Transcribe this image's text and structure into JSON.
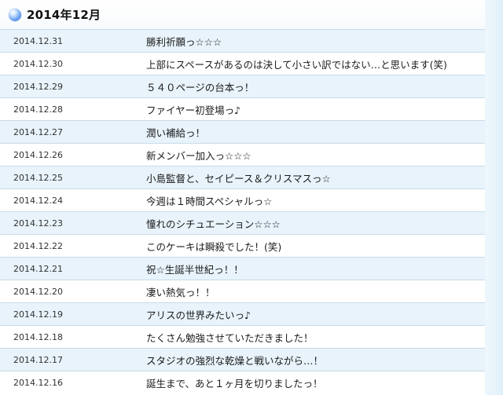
{
  "header": {
    "month_title": "2014年12月"
  },
  "entries": [
    {
      "date": "2014.12.31",
      "title": "勝利祈願っ☆☆☆"
    },
    {
      "date": "2014.12.30",
      "title": "上部にスペースがあるのは決して小さい訳ではない…と思います(笑)"
    },
    {
      "date": "2014.12.29",
      "title": "５４０ページの台本っ！"
    },
    {
      "date": "2014.12.28",
      "title": "ファイヤー初登場っ♪"
    },
    {
      "date": "2014.12.27",
      "title": "潤い補給っ！"
    },
    {
      "date": "2014.12.26",
      "title": "新メンバー加入っ☆☆☆"
    },
    {
      "date": "2014.12.25",
      "title": "小島監督と、セイピース＆クリスマスっ☆"
    },
    {
      "date": "2014.12.24",
      "title": "今週は１時間スペシャルっ☆"
    },
    {
      "date": "2014.12.23",
      "title": "憧れのシチュエーション☆☆☆"
    },
    {
      "date": "2014.12.22",
      "title": "このケーキは瞬殺でした！(笑)"
    },
    {
      "date": "2014.12.21",
      "title": "祝☆生誕半世紀っ！！"
    },
    {
      "date": "2014.12.20",
      "title": "凄い熱気っ！！"
    },
    {
      "date": "2014.12.19",
      "title": "アリスの世界みたいっ♪"
    },
    {
      "date": "2014.12.18",
      "title": "たくさん勉強させていただきました！"
    },
    {
      "date": "2014.12.17",
      "title": "スタジオの強烈な乾燥と戦いながら…！"
    },
    {
      "date": "2014.12.16",
      "title": "誕生まで、あと１ヶ月を切りましたっ！"
    }
  ]
}
